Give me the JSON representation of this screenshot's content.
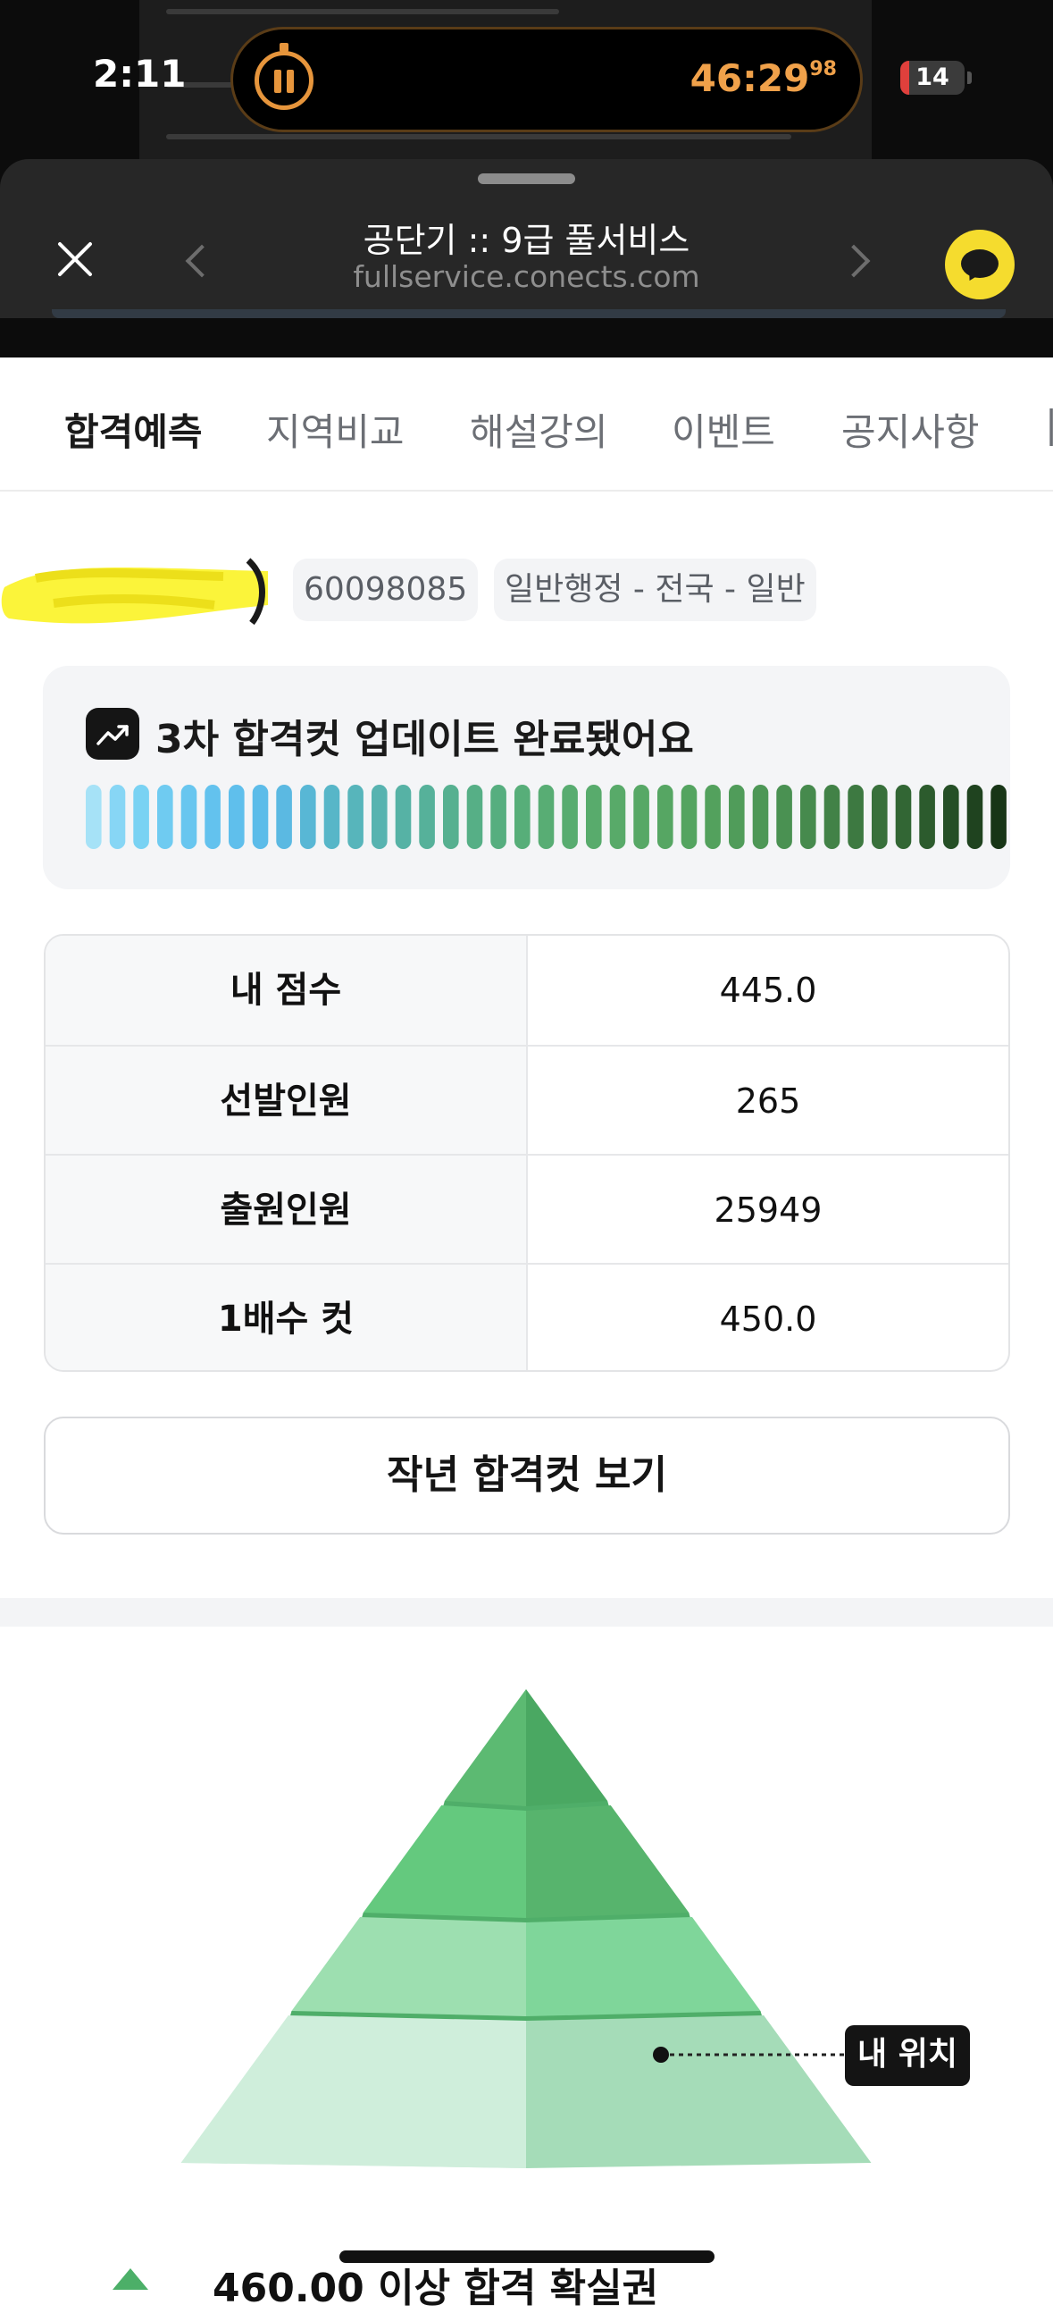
{
  "status_bar": {
    "time": "2:11",
    "timer": "46:29",
    "timer_centis": "98",
    "battery_level": "14",
    "battery_fraction": 0.14
  },
  "browser": {
    "title": "공단기 :: 9급 풀서비스",
    "url": "fullservice.conects.com"
  },
  "tabs": [
    {
      "label": "합격예측",
      "active": true
    },
    {
      "label": "지역비교",
      "active": false
    },
    {
      "label": "해설강의",
      "active": false
    },
    {
      "label": "이벤트",
      "active": false
    },
    {
      "label": "공지사항",
      "active": false
    }
  ],
  "profile": {
    "exam_number": "60098085",
    "category": "일반행정 - 전국 - 일반"
  },
  "banner": {
    "text": "3차 합격컷 업데이트 완료됐어요",
    "bar_colors": [
      "#a6e2f7",
      "#87d6f5",
      "#79d2f3",
      "#6fcbf1",
      "#68c6ef",
      "#63c2ee",
      "#5fbfec",
      "#5cbce9",
      "#5bb9e2",
      "#58b7d5",
      "#57b6c8",
      "#57b5bb",
      "#57b3b0",
      "#56b2a5",
      "#56b19a",
      "#56b090",
      "#56af86",
      "#56ae7f",
      "#57ae79",
      "#58ad74",
      "#58ac70",
      "#58ab6c",
      "#58aa69",
      "#57a866",
      "#56a663",
      "#54a460",
      "#53a15d",
      "#509c5a",
      "#4d9756",
      "#4a9152",
      "#468a4d",
      "#428247",
      "#3d7941",
      "#38703b",
      "#326634",
      "#2c5b2d",
      "#254f26",
      "#1f431f",
      "#173516"
    ]
  },
  "stats": [
    {
      "label": "내 점수",
      "value": "445.0"
    },
    {
      "label": "선발인원",
      "value": "265"
    },
    {
      "label": "출원인원",
      "value": "25949"
    },
    {
      "label": "1배수 컷",
      "value": "450.0"
    }
  ],
  "last_year_button": "작년 합격컷 보기",
  "pyramid": {
    "position_label": "내 위치",
    "tier_colors": [
      {
        "left": "#5cba72",
        "right": "#4aa862"
      },
      {
        "left": "#64c97e",
        "right": "#57b46d"
      },
      {
        "left": "#9ddfb0",
        "right": "#7fd69a"
      },
      {
        "left": "#cfeedb",
        "right": "#a5dcb8"
      }
    ],
    "band_color": "#4fae69"
  },
  "bottom_text": "460.00 이상 합격 확실권"
}
